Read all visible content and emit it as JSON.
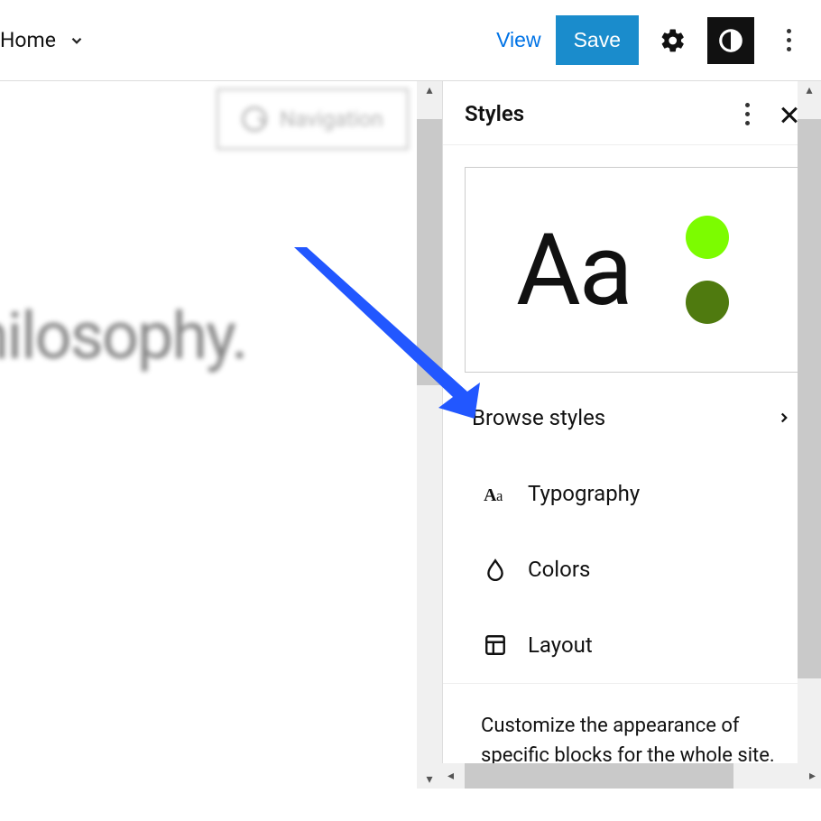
{
  "topbar": {
    "home": "Home",
    "view": "View",
    "save": "Save"
  },
  "canvas": {
    "nav_label": "Navigation",
    "headline": "hilosophy."
  },
  "panel": {
    "title": "Styles",
    "preview_sample": "Aa",
    "swatch1": "#7CFC00",
    "swatch2": "#4F7A0F",
    "browse": "Browse styles",
    "items": {
      "typography": "Typography",
      "colors": "Colors",
      "layout": "Layout"
    },
    "description": "Customize the appearance of specific blocks for the whole site."
  },
  "colors": {
    "accent": "#1a8ccc",
    "link": "#0073e6"
  }
}
